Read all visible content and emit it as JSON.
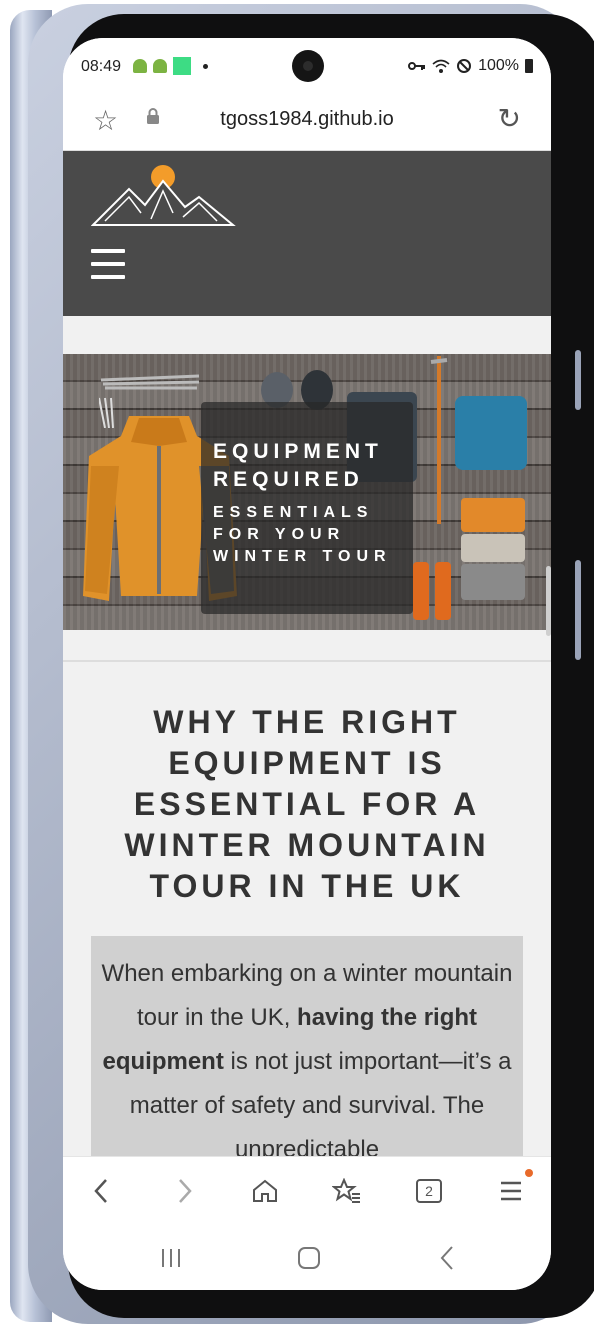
{
  "status_bar": {
    "time": "08:49",
    "battery_text": "100%"
  },
  "browser": {
    "url": "tgoss1984.github.io",
    "tab_count": "2"
  },
  "hero": {
    "title": "EQUIPMENT REQUIRED",
    "subtitle": "ESSENTIALS FOR YOUR WINTER TOUR"
  },
  "section": {
    "title": "WHY THE RIGHT EQUIPMENT IS ESSENTIAL FOR A WINTER MOUNTAIN TOUR IN THE UK",
    "intro_before": "When embarking on a winter mountain tour in the UK, ",
    "intro_bold": "having the right equipment",
    "intro_after": " is not just important—it’s a matter of safety and survival. The unpredictable"
  },
  "colors": {
    "header_bg": "#4a4a4a",
    "sun": "#f39c2a",
    "textbox_bg": "#d0d0d0"
  }
}
